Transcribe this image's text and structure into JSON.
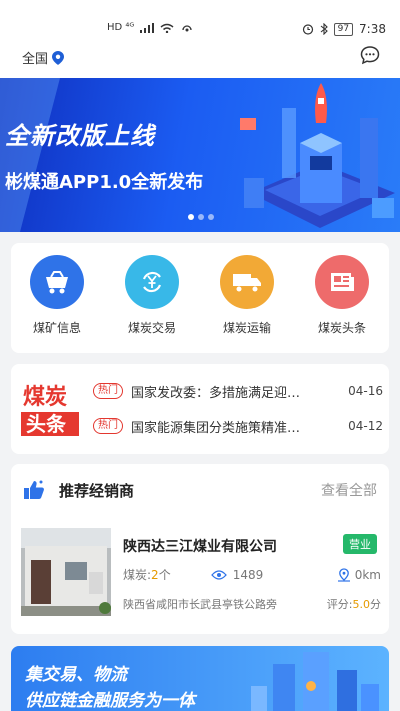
{
  "status_bar": {
    "network": "HD ⁴ᴳ",
    "time": "7:38",
    "battery": "97"
  },
  "top_bar": {
    "location": "全国"
  },
  "banner": {
    "title": "全新改版上线",
    "subtitle": "彬煤通APP1.0全新发布"
  },
  "categories": [
    {
      "label": "煤矿信息",
      "icon": "mine-cart-icon",
      "color": "#2f73e8"
    },
    {
      "label": "煤炭交易",
      "icon": "yuan-exchange-icon",
      "color": "#38b8e8"
    },
    {
      "label": "煤炭运输",
      "icon": "truck-icon",
      "color": "#f2a936"
    },
    {
      "label": "煤炭头条",
      "icon": "newspaper-icon",
      "color": "#ee6b6b"
    }
  ],
  "news": {
    "logo_line1": "煤炭",
    "logo_line2": "头条",
    "items": [
      {
        "tag": "热门",
        "title": "国家发改委：多措施满足迎峰度夏",
        "date": "04-16"
      },
      {
        "tag": "热门",
        "title": "国家能源集团分类施策精准管控",
        "date": "04-12"
      }
    ]
  },
  "dealers": {
    "title": "推荐经销商",
    "see_all": "查看全部",
    "items": [
      {
        "name": "陕西达三江煤业有限公司",
        "status": "营业",
        "coal_label": "煤炭:",
        "coal_count": "2",
        "coal_unit": "个",
        "views": "1489",
        "distance": "0km",
        "address": "陕西省咸阳市长武县亭铁公路旁",
        "score_label": "评分:",
        "score": "5.0",
        "score_unit": "分"
      }
    ]
  },
  "bottom_banner": {
    "line1": "集交易、物流",
    "line2": "供应链金融服务为一体"
  }
}
